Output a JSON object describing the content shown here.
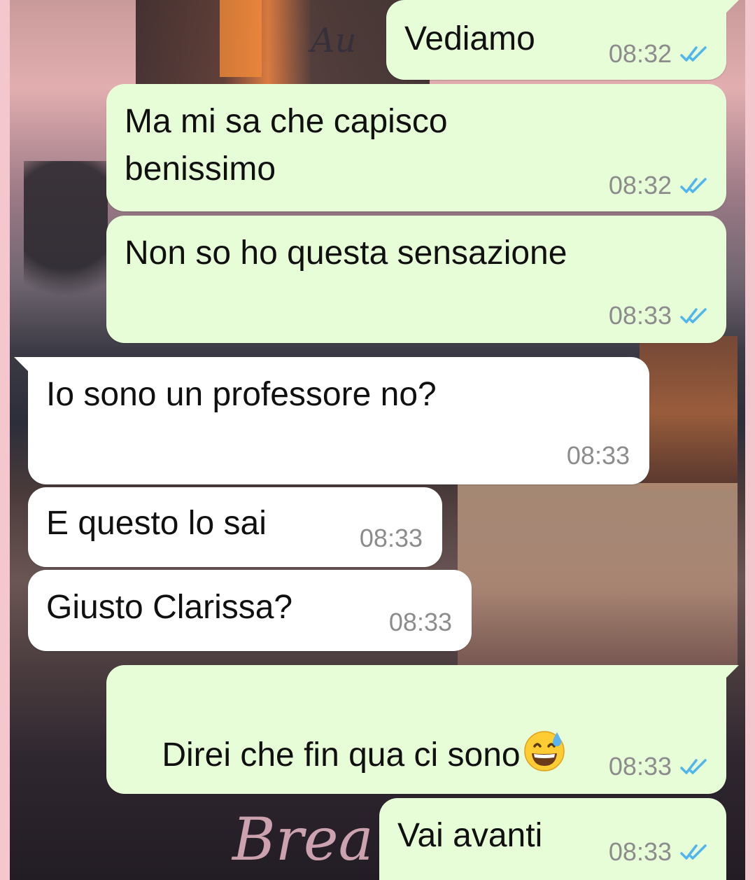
{
  "wallpaper": {
    "script_bottom": "Brea",
    "script_top": "Au"
  },
  "messages": [
    {
      "direction": "outgoing",
      "text": "Vediamo",
      "time": "08:32",
      "status_icon": "double-check-read-icon"
    },
    {
      "direction": "outgoing",
      "text": "Ma mi sa che capisco\nbenissimo",
      "time": "08:32",
      "status_icon": "double-check-read-icon"
    },
    {
      "direction": "outgoing",
      "text": "Non so ho questa sensazione",
      "time": "08:33",
      "status_icon": "double-check-read-icon"
    },
    {
      "direction": "incoming",
      "text": "Io sono un professore no?",
      "time": "08:33"
    },
    {
      "direction": "incoming",
      "text": "E questo lo sai",
      "time": "08:33"
    },
    {
      "direction": "incoming",
      "text": "Giusto Clarissa?",
      "time": "08:33"
    },
    {
      "direction": "outgoing",
      "text": "Direi che fin qua ci sono",
      "emoji": "grinning-face-with-sweat-emoji",
      "time": "08:33",
      "status_icon": "double-check-read-icon"
    },
    {
      "direction": "outgoing",
      "text": "Vai avanti",
      "time": "08:33",
      "status_icon": "double-check-read-icon"
    }
  ],
  "colors": {
    "outgoing_bubble": "#e7fdd8",
    "incoming_bubble": "#ffffff",
    "read_ticks": "#4fb6ec",
    "timestamp": "#8c8c8c",
    "frame": "#f4c7cf"
  }
}
